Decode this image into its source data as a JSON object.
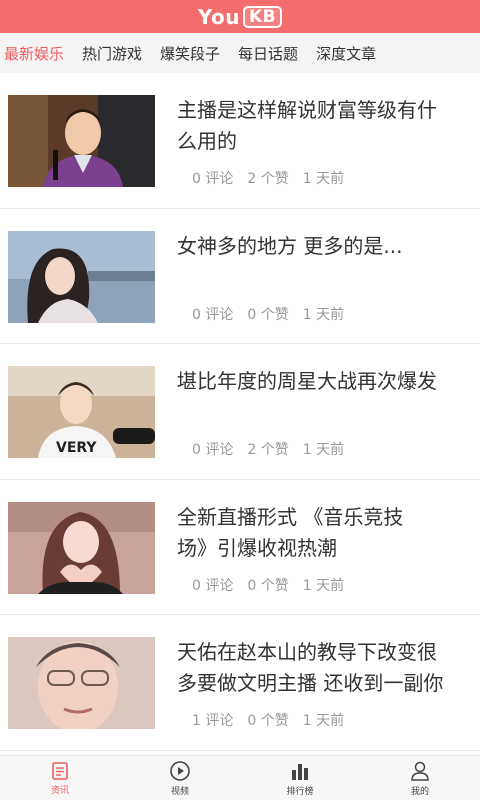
{
  "header": {
    "logo_text": "You",
    "logo_box_text": "KB",
    "accent_color": "#f36d6d"
  },
  "tabs": [
    {
      "label": "最新娱乐",
      "active": true
    },
    {
      "label": "热门游戏",
      "active": false
    },
    {
      "label": "爆笑段子",
      "active": false
    },
    {
      "label": "每日话题",
      "active": false
    },
    {
      "label": "深度文章",
      "active": false
    }
  ],
  "articles": [
    {
      "title_lines": [
        "主播是这样解说财富等级有什",
        "么用的"
      ],
      "comments": "0 评论",
      "likes": "2 个赞",
      "time": "1 天前",
      "thumb": "man-purple-suit"
    },
    {
      "title_lines": [
        "女神多的地方 更多的是..."
      ],
      "comments": "0 评论",
      "likes": "0 个赞",
      "time": "1 天前",
      "thumb": "woman-seaside"
    },
    {
      "title_lines": [
        "堪比年度的周星大战再次爆发"
      ],
      "comments": "0 评论",
      "likes": "2 个赞",
      "time": "1 天前",
      "thumb": "young-man-microphone"
    },
    {
      "title_lines": [
        "全新直播形式 《音乐竞技",
        "场》引爆收视热潮"
      ],
      "comments": "0 评论",
      "likes": "0 个赞",
      "time": "1 天前",
      "thumb": "girl-heart-hands"
    },
    {
      "title_lines": [
        "天佑在赵本山的教导下改变很",
        "多要做文明主播 还收到一副你"
      ],
      "comments": "1 评论",
      "likes": "0 个赞",
      "time": "1 天前",
      "thumb": "man-glasses"
    }
  ],
  "bottom_nav": [
    {
      "label": "资讯",
      "icon": "news-icon",
      "active": true
    },
    {
      "label": "视频",
      "icon": "play-icon",
      "active": false
    },
    {
      "label": "排行榜",
      "icon": "bar-chart-icon",
      "active": false
    },
    {
      "label": "我的",
      "icon": "user-icon",
      "active": false
    }
  ]
}
